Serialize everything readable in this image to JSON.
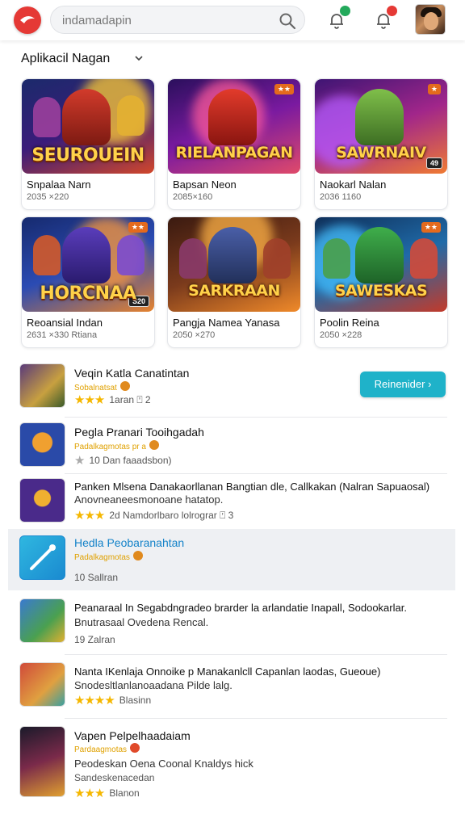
{
  "header": {
    "search_placeholder": "indamadapin"
  },
  "section": {
    "title": "Aplikacil Nagan"
  },
  "grid": [
    {
      "thumb_title": "SEUROUEIN",
      "name": "Snpalaa Narn",
      "meta": "2035 ×220"
    },
    {
      "thumb_title": "RIELANPAGAN",
      "name": "Bapsan Neon",
      "meta": "2085×160"
    },
    {
      "thumb_title": "SAWRNAIV",
      "name": "Naokarl Nalan",
      "meta": "2036 1160"
    },
    {
      "thumb_title": "HORCNAA",
      "name": "Reoansial Indan",
      "meta": "2631 ×330 Rtiana"
    },
    {
      "thumb_title": "SARKRAAN",
      "name": "Pangja Namea Yanasa",
      "meta": "2050 ×270"
    },
    {
      "thumb_title": "SAWESKAS",
      "name": "Poolin Reina",
      "meta": "2050 ×228"
    }
  ],
  "list": [
    {
      "title": "Veqin Katla Canatintan",
      "sub": "Sobalnatsat",
      "meta": "1aran  ⍞ 2"
    },
    {
      "title": "Pegla Pranari Tooihgadah",
      "sub": "Padalkagmotas pr a",
      "meta": "10  Dan  faaadsbon)"
    },
    {
      "title": "Panken Mlsena Danakaorllanan Bangtian dle, Callkakan (Nalran Sapuaosal)",
      "sub2": "Anovneaneesmonoane hatatop.",
      "meta": "2d  Namdorlbaro lolrograr ⍞ 3"
    },
    {
      "title": "Hedla Peobaranahtan",
      "sub": "Padalkagmotas",
      "meta": "10  Sallran"
    },
    {
      "title": "Peanaraal In Segabdngradeo brarder la arlandatie Inapall, Sodookarlar.",
      "sub2": "Bnutrasaal Ovedena Rencal.",
      "meta": "19  Zalran"
    },
    {
      "title": "Nanta IKenlaja Onnoike p Manakanlcll Capanlan laodas, Gueoue)",
      "sub2": "Snodesltlanlanoaadana Pilde lalg.",
      "meta": "Blasinn"
    },
    {
      "title": "Vapen Pelpelhaadaiam",
      "sub": "Pardaagmotas",
      "sub2": "Peodeskan Oena Coonal Knaldys hick",
      "sub3": "Sandeskenacedan",
      "meta": "Blanon"
    }
  ],
  "cta": {
    "label": "Reinenider  ›"
  },
  "colors": {
    "brand": "#e53935",
    "accent": "#1fb2c9",
    "star": "#f5b700"
  }
}
